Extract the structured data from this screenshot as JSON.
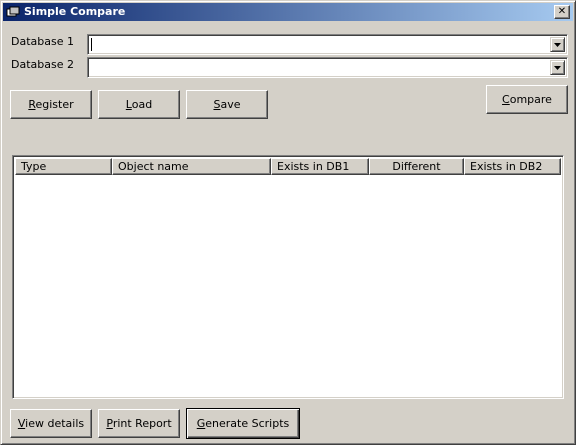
{
  "window": {
    "title": "Simple Compare",
    "close_glyph": "✕"
  },
  "form": {
    "db1_label": "Database 1",
    "db2_label": "Database 2",
    "db1_value": "",
    "db2_value": ""
  },
  "buttons": {
    "register": {
      "accel": "R",
      "rest": "egister"
    },
    "load": {
      "accel": "L",
      "rest": "oad"
    },
    "save": {
      "accel": "S",
      "rest": "ave"
    },
    "compare": {
      "accel": "C",
      "rest": "ompare"
    },
    "view_details": {
      "accel": "V",
      "rest": "iew details"
    },
    "print_report": {
      "accel": "P",
      "rest": "rint Report"
    },
    "generate_scripts": {
      "accel": "G",
      "rest": "enerate Scripts"
    }
  },
  "list": {
    "columns": [
      "Type",
      "Object name",
      "Exists in DB1",
      "Different",
      "Exists in DB2"
    ],
    "rows": []
  },
  "colors": {
    "title_start": "#0a246a",
    "title_end": "#a6caf0",
    "face": "#d4d0c8"
  }
}
